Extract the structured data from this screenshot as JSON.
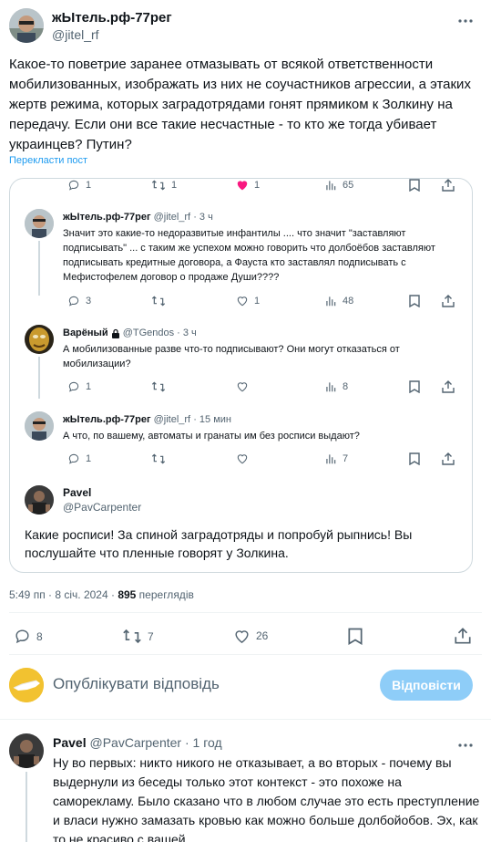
{
  "main_tweet": {
    "display_name": "жЫтель.рф-77рег",
    "handle": "@jitel_rf",
    "text": "Какое-то поветрие заранее отмазывать от всякой ответственности мобилизованных, изображать из них не соучастников агрессии, а этаких жертв режима, которых заградотрядами гонят прямиком к Золкину на передачу. Если они все такие несчастные - то кто же тогда убивает украинцев? Путин?",
    "translate": "Перекласти пост",
    "time": "5:49 пп · 8 січ. 2024 · ",
    "views_count": "895",
    "views_label": " переглядів",
    "stats": {
      "replies": "8",
      "retweets": "7",
      "likes": "26"
    }
  },
  "quoted": {
    "top_stats": {
      "replies": "1",
      "retweets": "1",
      "likes": "1",
      "views": "65"
    },
    "reply1": {
      "display_name": "жЫтель.рф-77рег",
      "handle": "@jitel_rf",
      "time": "· 3 ч",
      "text": "Значит это какие-то недоразвитые инфантилы .... что значит \"заставляют подписывать\" ... с таким же успехом можно говорить что долбоёбов заставляют подписывать кредитные договора, а Фауста кто заставлял подписывать с Мефистофелем договор о продаже Души????",
      "stats": {
        "replies": "3",
        "retweets": "",
        "likes": "1",
        "views": "48"
      }
    },
    "reply2": {
      "display_name": "Варёный",
      "handle": "@TGendos",
      "time": "· 3 ч",
      "text": "А мобилизованные разве что-то подписывают? Они могут отказаться от мобилизации?",
      "stats": {
        "replies": "1",
        "retweets": "",
        "likes": "",
        "views": "8"
      }
    },
    "reply3": {
      "display_name": "жЫтель.рф-77рег",
      "handle": "@jitel_rf",
      "time": "· 15 мин",
      "text": "А что, по вашему, автоматы и гранаты им без росписи выдают?",
      "stats": {
        "replies": "1",
        "retweets": "",
        "likes": "",
        "views": "7"
      }
    },
    "reply4": {
      "display_name": "Pavel",
      "handle": "@PavCarpenter",
      "text": "Какие росписи! За спиной заградотряды и попробуй рыпнись! Вы послушайте что пленные говорят у Золкина."
    }
  },
  "compose": {
    "placeholder": "Опублікувати відповідь",
    "button": "Відповісти"
  },
  "bottom_reply": {
    "display_name": "Pavel",
    "handle": "@PavCarpenter",
    "time": "· 1 год",
    "text": "Ну во первых: никто никого не отказывает, а во вторых - почему вы выдернули из беседы только этот контекст - это похоже на саморекламу. Было сказано что в любом случае это есть преступление и власи нужно замазать кровью как можно больше долбойобов. Эх, как то не красиво с вашей."
  },
  "colors": {
    "accent": "#1d9bf0",
    "like_active": "#f91880",
    "muted": "#536471",
    "border": "#cfd9de"
  }
}
